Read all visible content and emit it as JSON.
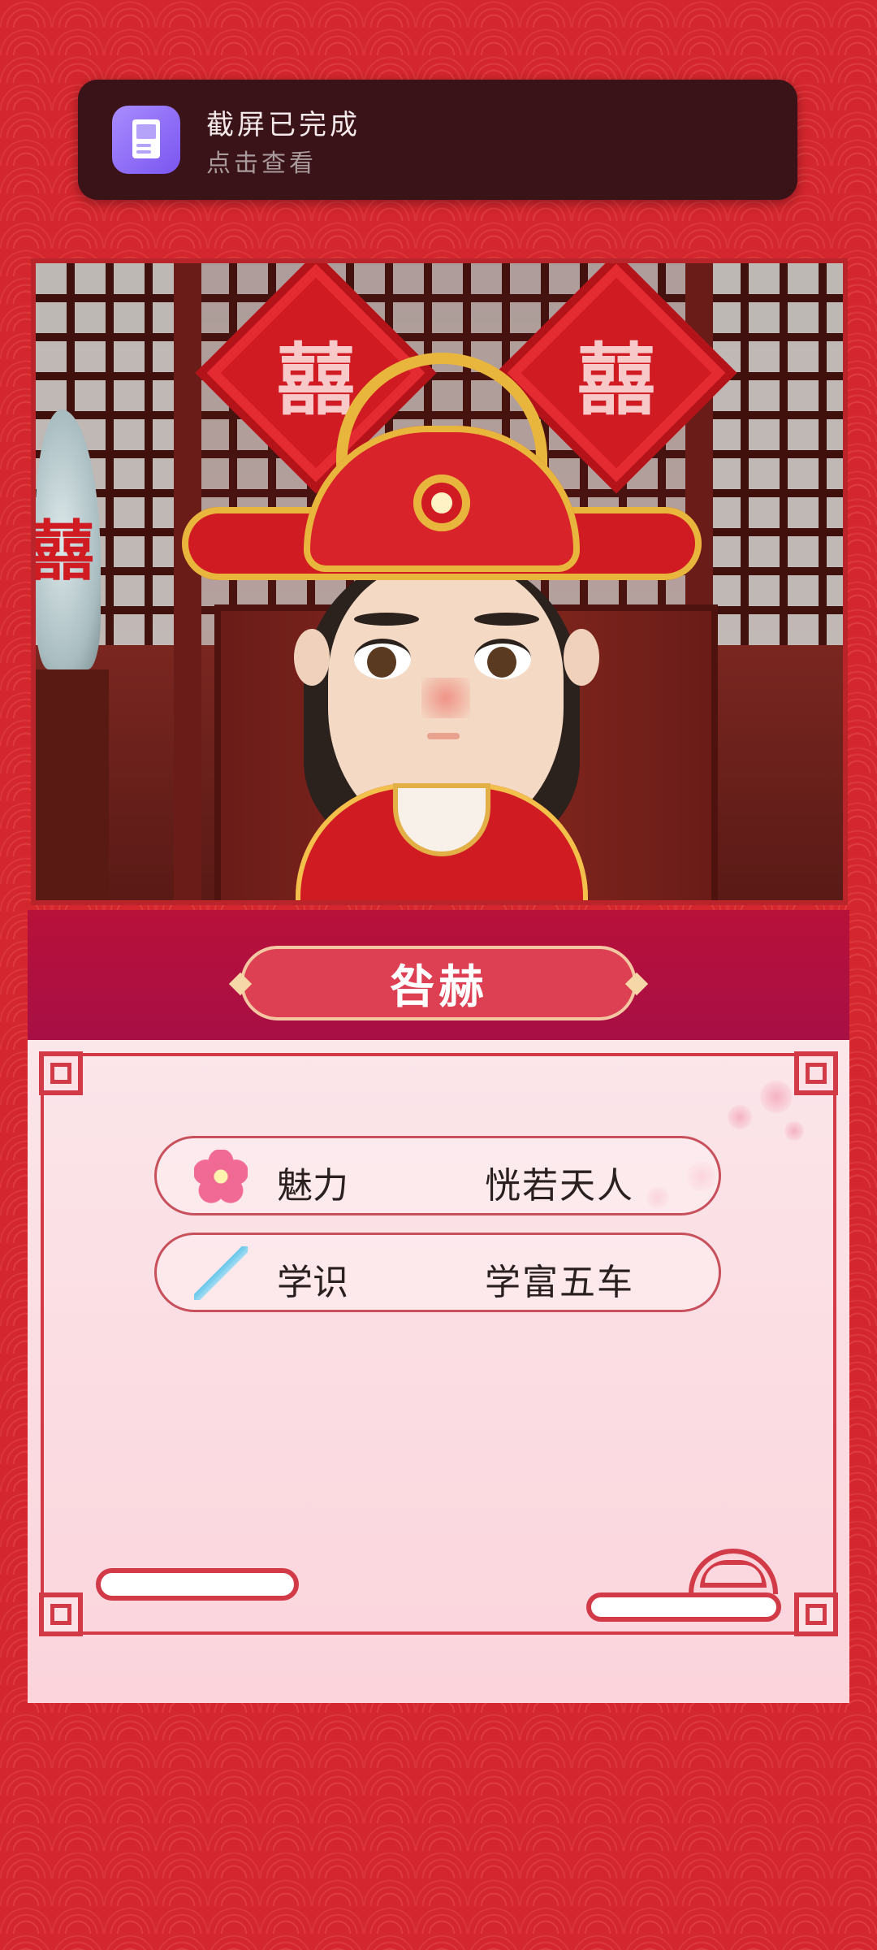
{
  "notification": {
    "icon": "screenshot-app-icon",
    "title": "截屏已完成",
    "subtitle": "点击查看"
  },
  "scene": {
    "decorations": [
      "囍",
      "囍"
    ]
  },
  "character": {
    "name": "咎赫"
  },
  "stats": [
    {
      "icon": "plum-blossom-icon",
      "label": "魅力",
      "value": "恍若天人"
    },
    {
      "icon": "brush-icon",
      "label": "学识",
      "value": "学富五车"
    }
  ],
  "colors": {
    "background": "#d4262e",
    "name_band": "#b8113a",
    "name_plate": "#dc4052",
    "panel": "#fbe0e6",
    "frame": "#d23a48"
  }
}
